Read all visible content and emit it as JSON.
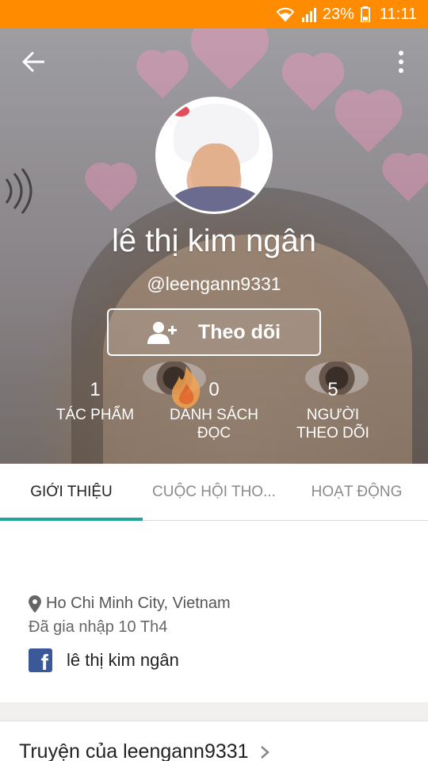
{
  "status_bar": {
    "battery": "23%",
    "time": "11:11",
    "bg_color": "#ff8c00"
  },
  "header": {
    "back_icon": "arrow-left-icon",
    "more_icon": "more-vertical-icon"
  },
  "profile": {
    "name": "lê thị kim ngân",
    "handle": "@leengann9331",
    "follow_label": "Theo dõi",
    "follow_icon": "person-add-icon"
  },
  "stats": [
    {
      "value": "1",
      "label": "TÁC PHẨM"
    },
    {
      "value": "0",
      "label": "DANH SÁCH ĐỌC"
    },
    {
      "value": "5",
      "label": "NGƯỜI THEO DÕI"
    }
  ],
  "tabs": [
    {
      "label": "GIỚI THIỆU",
      "active": true
    },
    {
      "label": "CUỘC HỘI THO...",
      "active": false
    },
    {
      "label": "HOẠT ĐỘNG",
      "active": false
    }
  ],
  "about": {
    "location": "Ho Chi Minh City, Vietnam",
    "joined": "Đã gia nhập 10 Th4",
    "facebook_name": "lê thị kim ngân"
  },
  "stories": {
    "title": "Truyện của leengann9331"
  },
  "colors": {
    "accent": "#1fa4a0",
    "facebook": "#3b5998"
  }
}
